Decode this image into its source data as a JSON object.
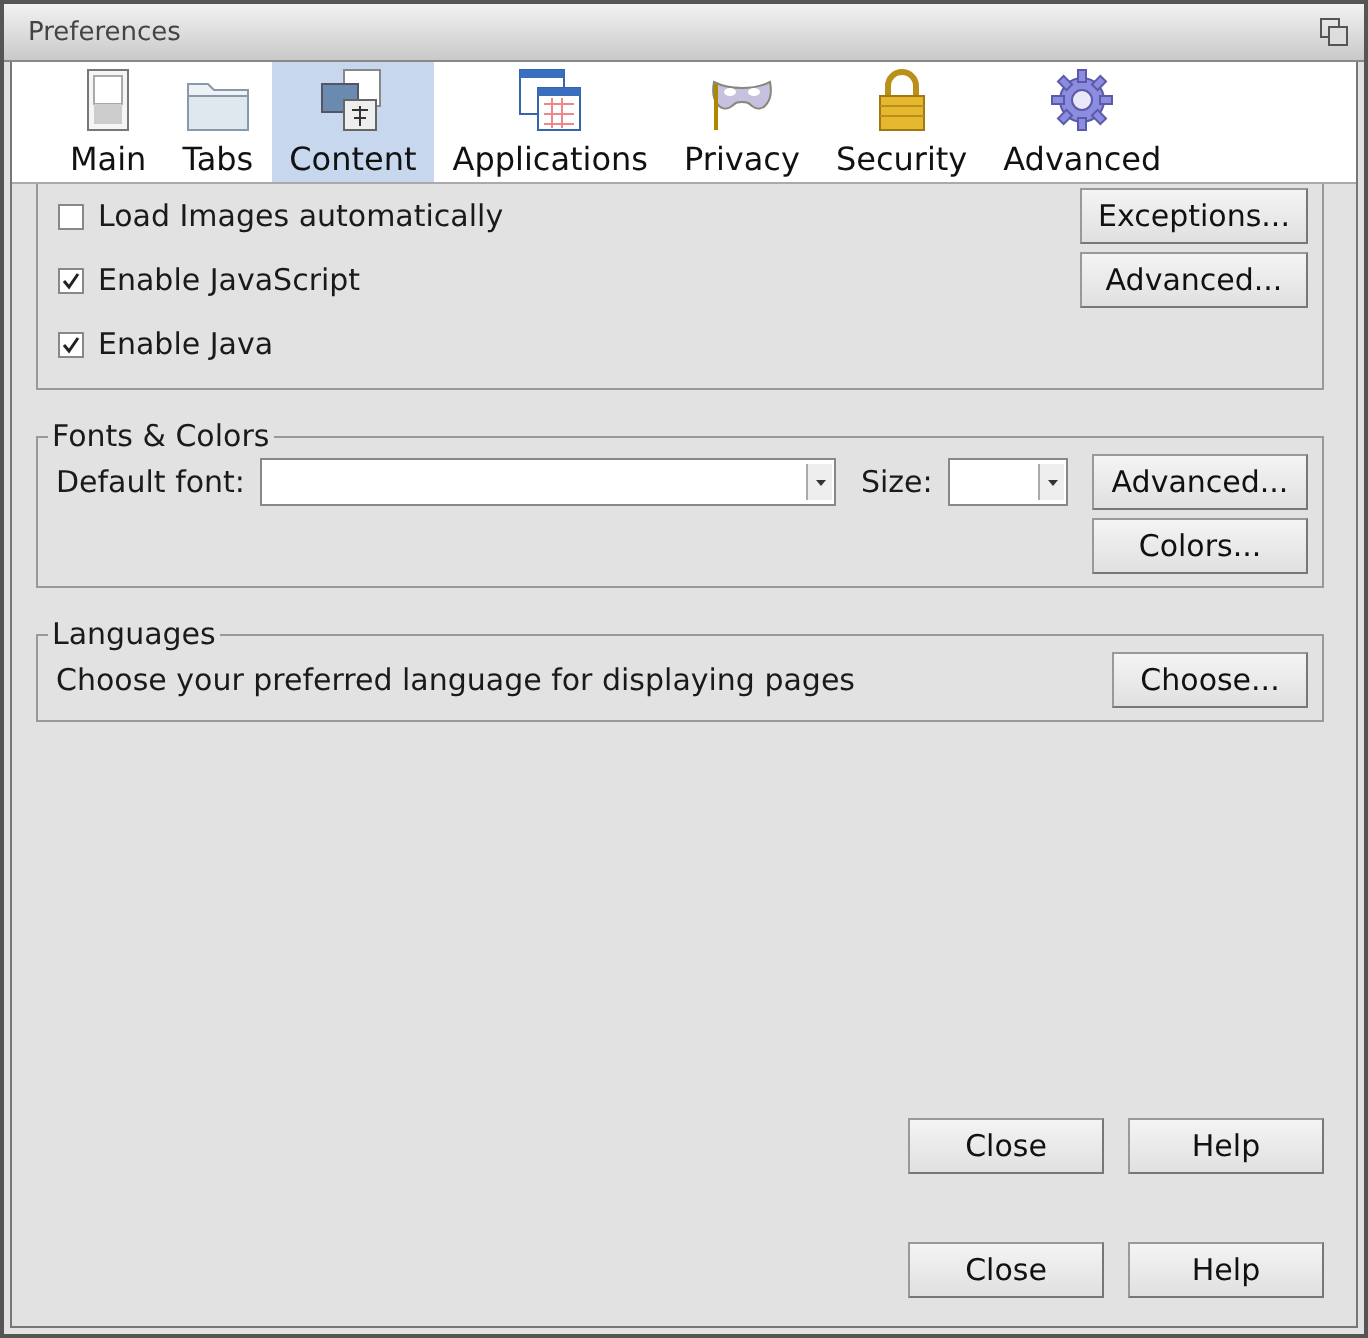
{
  "window": {
    "title": "Preferences"
  },
  "tabs": [
    {
      "label": "Main",
      "selected": false
    },
    {
      "label": "Tabs",
      "selected": false
    },
    {
      "label": "Content",
      "selected": true
    },
    {
      "label": "Applications",
      "selected": false
    },
    {
      "label": "Privacy",
      "selected": false
    },
    {
      "label": "Security",
      "selected": false
    },
    {
      "label": "Advanced",
      "selected": false
    }
  ],
  "content_options": [
    {
      "label": "Load Images automatically",
      "checked": false,
      "button": "Exceptions..."
    },
    {
      "label": "Enable JavaScript",
      "checked": true,
      "button": "Advanced..."
    },
    {
      "label": "Enable Java",
      "checked": true
    }
  ],
  "fonts_colors": {
    "title": "Fonts & Colors",
    "default_font_label": "Default font:",
    "size_label": "Size:",
    "advanced_button": "Advanced...",
    "colors_button": "Colors..."
  },
  "languages": {
    "title": "Languages",
    "text": "Choose your preferred language for displaying pages",
    "button": "Choose..."
  },
  "button_rows": [
    {
      "close": "Close",
      "help": "Help"
    },
    {
      "close": "Close",
      "help": "Help"
    }
  ]
}
